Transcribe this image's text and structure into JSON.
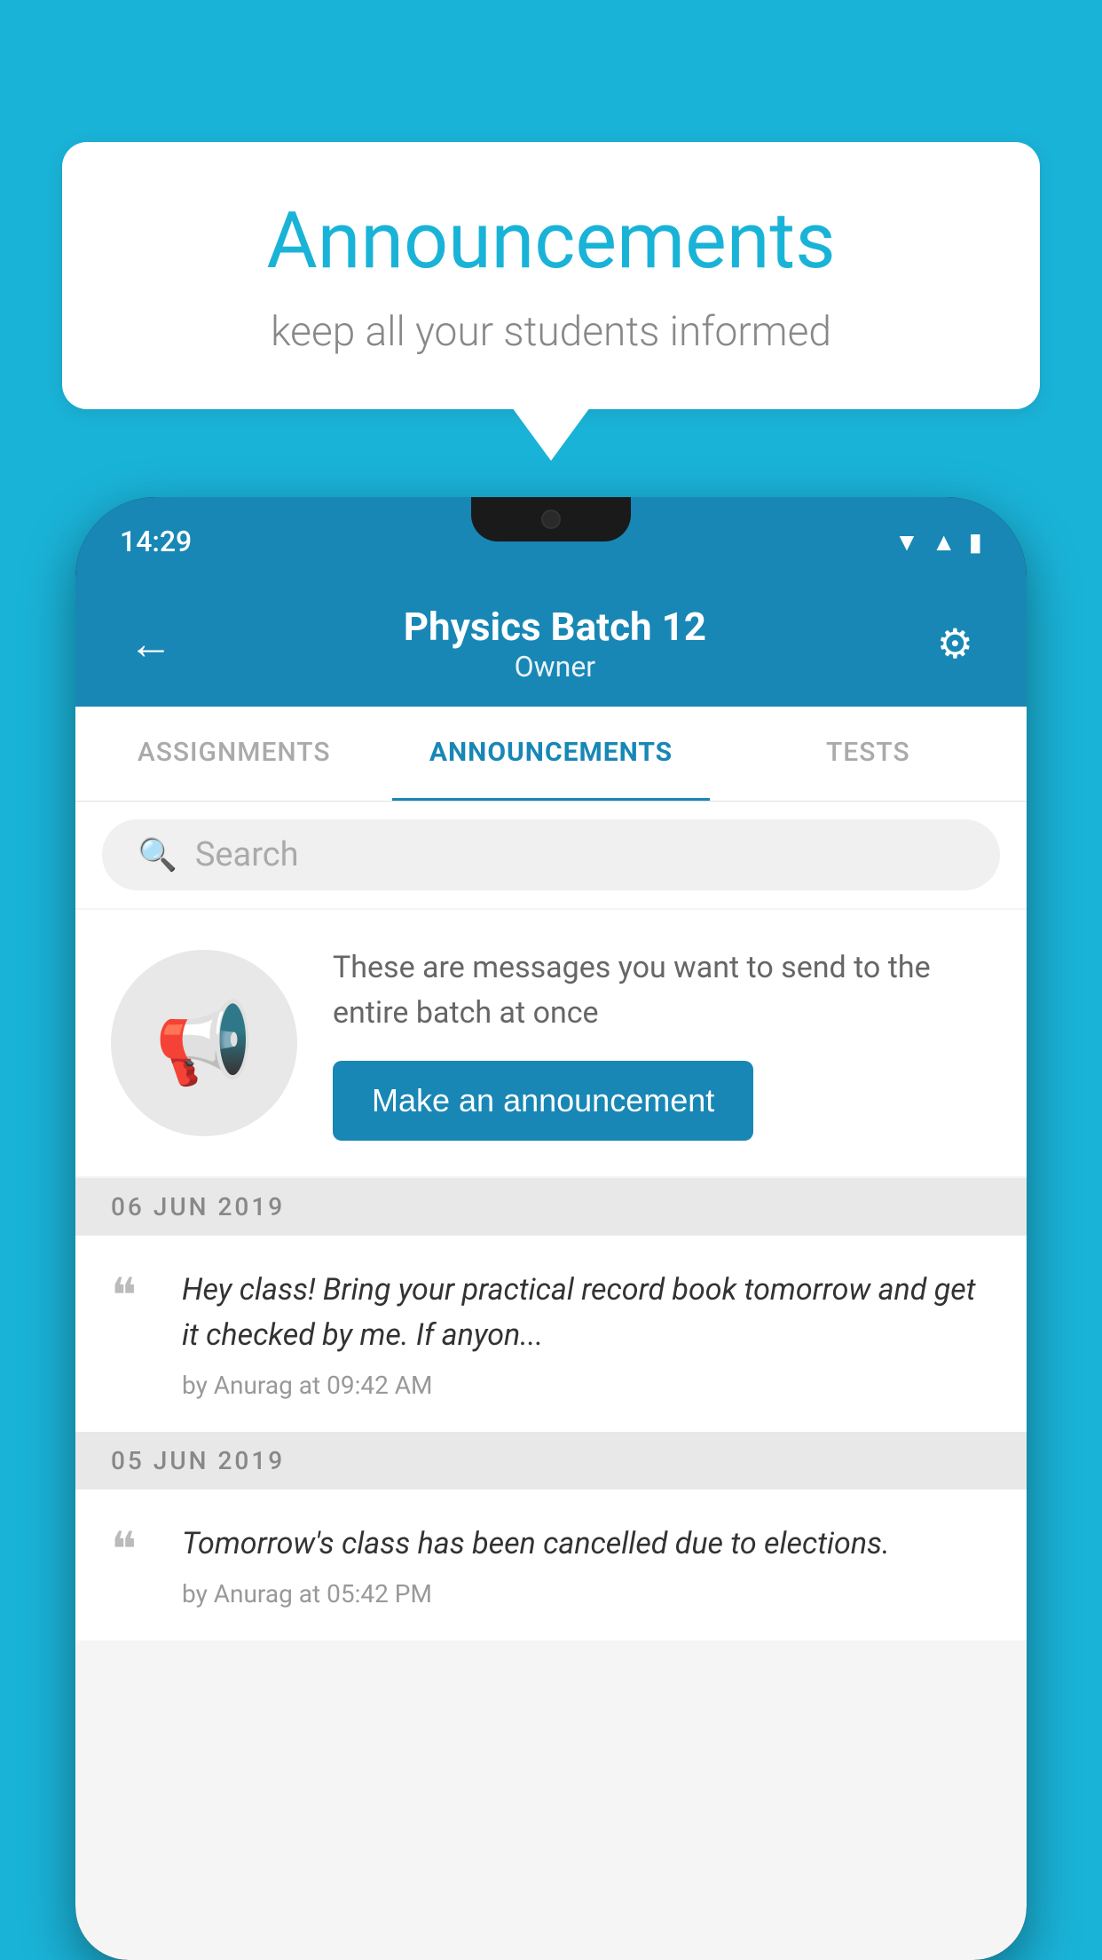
{
  "background_color": "#1ab3d8",
  "speech_bubble": {
    "title": "Announcements",
    "subtitle": "keep all your students informed"
  },
  "phone": {
    "status_bar": {
      "time": "14:29"
    },
    "header": {
      "title": "Physics Batch 12",
      "subtitle": "Owner",
      "back_label": "←",
      "settings_label": "⚙"
    },
    "tabs": [
      {
        "label": "ASSIGNMENTS",
        "active": false
      },
      {
        "label": "ANNOUNCEMENTS",
        "active": true
      },
      {
        "label": "TESTS",
        "active": false
      }
    ],
    "search": {
      "placeholder": "Search"
    },
    "promo_card": {
      "description": "These are messages you want to send to the entire batch at once",
      "button_label": "Make an announcement"
    },
    "announcements": [
      {
        "date": "06  JUN  2019",
        "text": "Hey class! Bring your practical record book tomorrow and get it checked by me. If anyon...",
        "meta": "by Anurag at 09:42 AM"
      },
      {
        "date": "05  JUN  2019",
        "text": "Tomorrow's class has been cancelled due to elections.",
        "meta": "by Anurag at 05:42 PM"
      }
    ]
  }
}
